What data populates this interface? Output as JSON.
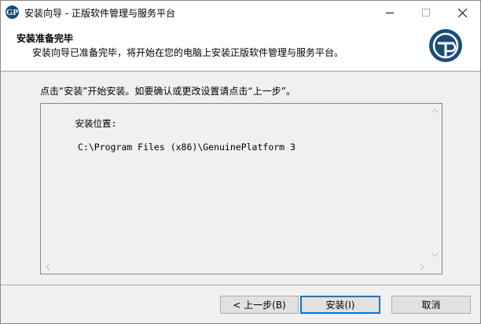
{
  "window": {
    "title": "安装向导 - 正版软件管理与服务平台",
    "app_icon_glyph": "GP"
  },
  "header": {
    "title": "安装准备完毕",
    "subtitle": "安装向导已准备完毕，将开始在您的电脑上安装正版软件管理与服务平台。",
    "logo_glyph": "GP"
  },
  "body": {
    "instruction": "点击“安装”开始安装。如要确认或更改设置请点击“上一步”。",
    "memo": {
      "label": "安装位置:",
      "path": "C:\\Program Files (x86)\\GenuinePlatform 3"
    }
  },
  "buttons": {
    "back": "< 上一步(B)",
    "install": "安装(I)",
    "cancel": "取消"
  },
  "colors": {
    "logo": "#1a4d7a",
    "focus_border": "#0078d7"
  }
}
